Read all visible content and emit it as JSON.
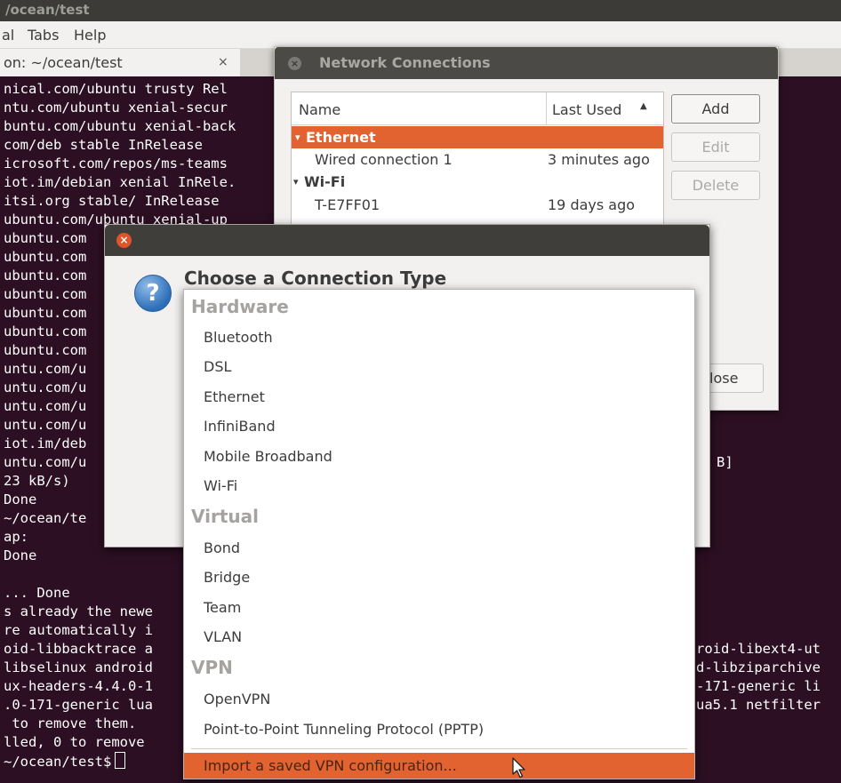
{
  "terminal": {
    "title": "/ocean/test",
    "menu": [
      "al",
      "Tabs",
      "Help"
    ],
    "tab_label": "on: ~/ocean/test",
    "tab_close": "×",
    "lines": [
      "nical.com/ubuntu trusty Rel",
      "ntu.com/ubuntu xenial-secur",
      "buntu.com/ubuntu xenial-back",
      "com/deb stable InRelease",
      "icrosoft.com/repos/ms-teams",
      "iot.im/debian xenial InRele.",
      "itsi.org stable/ InRelease",
      "ubuntu.com/ubuntu xenial-up",
      "ubuntu.com",
      "ubuntu.com",
      "ubuntu.com",
      "ubuntu.com",
      "ubuntu.com",
      "ubuntu.com",
      "ubuntu.com",
      "untu.com/u",
      "untu.com/u",
      "untu.com/u",
      "untu.com/u",
      "iot.im/deb",
      "untu.com/u",
      "23 kB/s)",
      "Done",
      "~/ocean/te",
      "ap:",
      "Done",
      "",
      "... Done",
      "s already the newe",
      "re automatically i",
      "oid-libbacktrace a",
      "libselinux android",
      "ux-headers-4.4.0-1",
      ".0-171-generic lua",
      " to remove them.",
      "lled, 0 to remove",
      "~/ocean/test$"
    ],
    "right_fragments": [
      "B]",
      "roid-libext4-ut",
      "d-libziparchive",
      "-171-generic li",
      "ua5.1 netfilter"
    ]
  },
  "network_connections": {
    "title": "Network Connections",
    "columns": {
      "name": "Name",
      "last_used": "Last Used"
    },
    "rows": [
      {
        "name": "Ethernet",
        "last_used": "",
        "kind": "group",
        "selected": true
      },
      {
        "name": "Wired connection 1",
        "last_used": "3 minutes ago",
        "kind": "item"
      },
      {
        "name": "Wi-Fi",
        "last_used": "",
        "kind": "group"
      },
      {
        "name": "T-E7FF01",
        "last_used": "19 days ago",
        "kind": "item"
      }
    ],
    "buttons": {
      "add": "Add",
      "edit": "Edit",
      "delete": "Delete",
      "close": "lose"
    }
  },
  "choose_dialog": {
    "heading": "Choose a Connection Type",
    "groups": [
      {
        "label": "Hardware",
        "items": [
          "Bluetooth",
          "DSL",
          "Ethernet",
          "InfiniBand",
          "Mobile Broadband",
          "Wi-Fi"
        ]
      },
      {
        "label": "Virtual",
        "items": [
          "Bond",
          "Bridge",
          "Team",
          "VLAN"
        ]
      },
      {
        "label": "VPN",
        "items": [
          "OpenVPN",
          "Point-to-Point Tunneling Protocol (PPTP)"
        ]
      }
    ],
    "highlighted_item": "Import a saved VPN configuration...",
    "selection_color": "#e26230"
  }
}
